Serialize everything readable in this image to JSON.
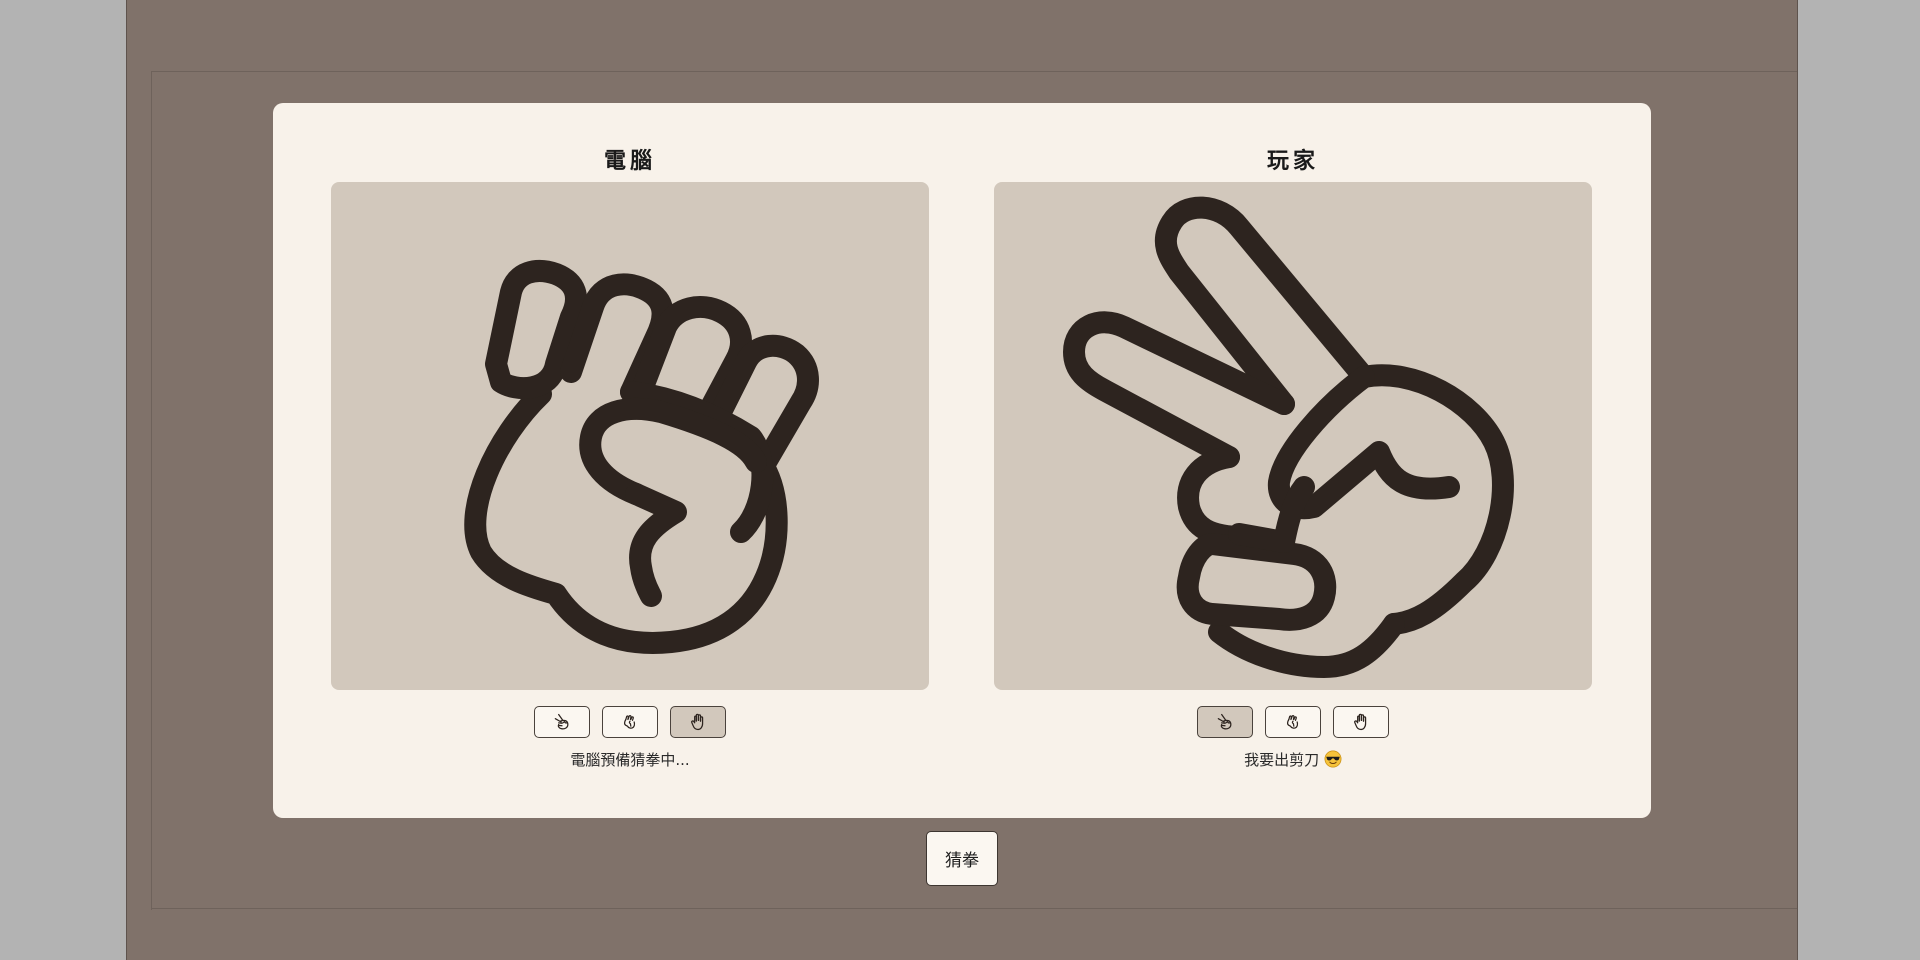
{
  "computer": {
    "title": "電腦",
    "status": "電腦預備猜拳中...",
    "shown_hand": "rock",
    "selected_choice": "paper"
  },
  "player": {
    "title": "玩家",
    "status": "我要出剪刀",
    "status_emoji": "cool-face-emoji",
    "shown_hand": "scissors",
    "selected_choice": "scissors"
  },
  "choices": [
    {
      "id": "scissors",
      "icon": "scissors-hand-icon"
    },
    {
      "id": "rock",
      "icon": "rock-hand-icon"
    },
    {
      "id": "paper",
      "icon": "paper-hand-icon"
    }
  ],
  "play_button_label": "猜拳",
  "colors": {
    "stage": "#80726a",
    "card": "#f8f2ea",
    "hand_box": "#d2c8bc",
    "ink": "#2d241f",
    "selected_button": "#d2c8bc"
  }
}
